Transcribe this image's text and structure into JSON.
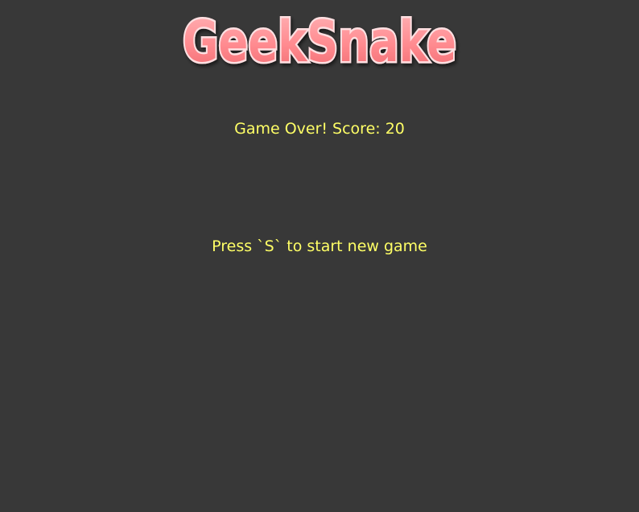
{
  "game": {
    "title": "GeekSnake",
    "game_over_text": "Game Over! Score: 20",
    "restart_hint": "Press `S` to start new game"
  },
  "colors": {
    "background": "#383838",
    "message_text": "#ffff66",
    "logo_fill": "#ff8a8f",
    "logo_outline": "#ffd4d6"
  }
}
